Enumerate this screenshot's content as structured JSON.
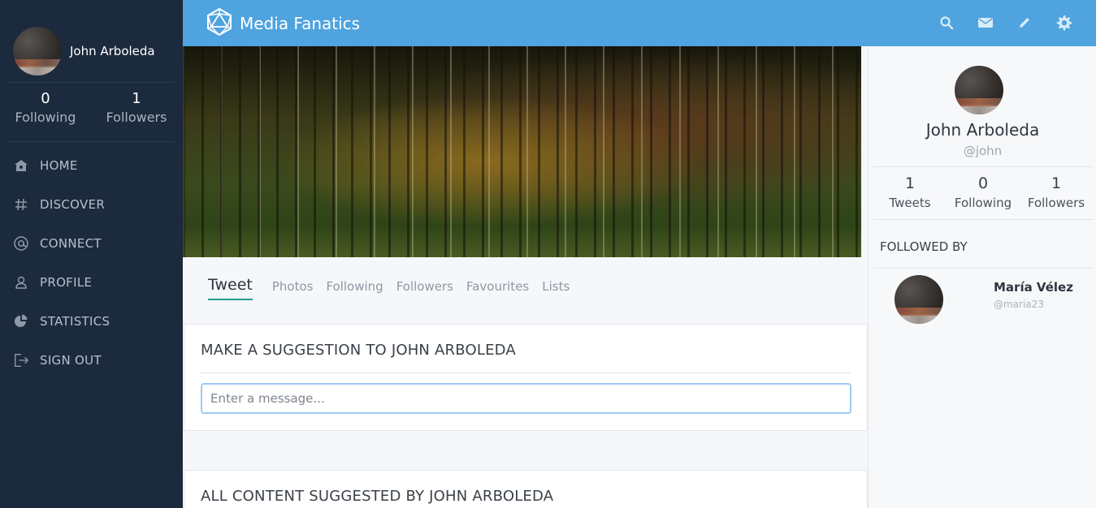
{
  "app": {
    "name": "Media Fanatics",
    "accent": "#4fa3de",
    "sidebar_bg": "#1b2a3d"
  },
  "sidebar": {
    "user_name": "John Arboleda",
    "stats": [
      {
        "value": "0",
        "label": "Following"
      },
      {
        "value": "1",
        "label": "Followers"
      }
    ],
    "nav": [
      {
        "label": "HOME",
        "icon": "home-icon"
      },
      {
        "label": "DISCOVER",
        "icon": "hash-icon"
      },
      {
        "label": "CONNECT",
        "icon": "at-icon"
      },
      {
        "label": "PROFILE",
        "icon": "user-icon"
      },
      {
        "label": "STATISTICS",
        "icon": "pie-chart-icon"
      },
      {
        "label": "SIGN OUT",
        "icon": "sign-out-icon"
      }
    ]
  },
  "header": {
    "icons": [
      "search-icon",
      "mail-icon",
      "pencil-icon",
      "gear-icon"
    ]
  },
  "tabs": [
    {
      "label": "Tweet",
      "active": true
    },
    {
      "label": "Photos"
    },
    {
      "label": "Following"
    },
    {
      "label": "Followers"
    },
    {
      "label": "Favourites"
    },
    {
      "label": "Lists"
    }
  ],
  "suggestion": {
    "title": "MAKE A SUGGESTION TO JOHN ARBOLEDA",
    "placeholder": "Enter a message..."
  },
  "suggested_content": {
    "title": "ALL CONTENT SUGGESTED BY JOHN ARBOLEDA"
  },
  "profile": {
    "name": "John Arboleda",
    "handle": "@john",
    "stats": [
      {
        "value": "1",
        "label": "Tweets"
      },
      {
        "value": "0",
        "label": "Following"
      },
      {
        "value": "1",
        "label": "Followers"
      }
    ],
    "followed_by_title": "FOLLOWED BY",
    "followed_by": [
      {
        "name": "María Vélez",
        "handle": "@maria23"
      }
    ]
  }
}
